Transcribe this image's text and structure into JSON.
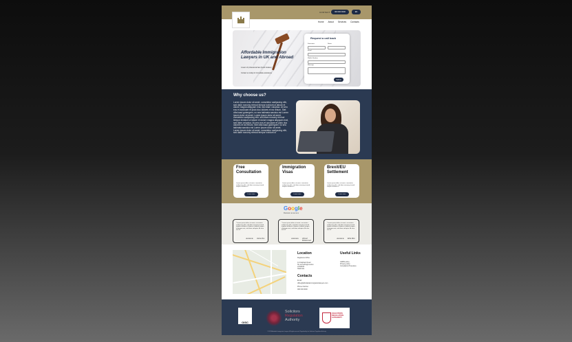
{
  "header": {
    "contact_label": "CONTACT",
    "phone_label": "000 000 0000",
    "lang_label": "EN"
  },
  "nav": [
    "Home",
    "About",
    "Services",
    "Contacts"
  ],
  "hero": {
    "title": "Affordable Immigration Lawyers in UK and Abroad",
    "subtitle1": "A team of professional law (Good Grades)",
    "subtitle2": "Contact us today for immediate assistance",
    "form": {
      "title": "Request a call back",
      "name_label": "Forename",
      "surname_label": "Name",
      "email_label": "Email",
      "phone_label": "Mobile Number",
      "message_label": "Message",
      "submit_label": "Submit"
    }
  },
  "why": {
    "title": "Why choose us?",
    "paragraph1": "Lorem ipsum dolor sit amet, consetetur sadipscing elitr, sed diam nonumy eirmod tempor invidunt ut labore et dolore magna aliquyam erat, sed diam voluptua. At vero eos et accusam et justo duo dolores et ea rebum. Stet clita kasd gubergren, no sea takimata sanctus est Lorem ipsum dolor sit amet. Lorem ipsum dolor sit amet, consetetur sadipscing elitr, sed diam nonumy eirmod tempor invidunt ut labore et dolore magna aliquyam erat, sed diam voluptua. At vero eos et accusam et justo duo dolores et ea rebum. Stet clita kasd gubergren, no sea takimata sanctus est Lorem ipsum dolor sit amet.",
    "paragraph2": "Lorem ipsum dolor sit amet, consetetur sadipscing elitr, sed diam nonumy eirmod tempor invidunt ut"
  },
  "services": [
    {
      "title": "Free Consultation",
      "text": "Lorem ipsum dolor sit amet, consetetur sadipscing elitr, sed diam nonumy eirmod tempor invidunt ut",
      "button": "Learn more"
    },
    {
      "title": "Immigration Visas",
      "text": "Lorem ipsum dolor sit amet, consetetur sadipscing elitr, sed diam nonumy eirmod tempor invidunt ut",
      "button": "Learn more"
    },
    {
      "title": "Brexit/EU Settlement",
      "text": "Lorem ipsum dolor sit amet, consetetur sadipscing elitr, sed diam nonumy eirmod tempor invidunt ut",
      "button": "Learn more"
    }
  ],
  "reviews": {
    "brand_letters": [
      "G",
      "o",
      "o",
      "g",
      "l",
      "e"
    ],
    "subtitle": "Reviews ★★★★★",
    "items": [
      {
        "text": "\"Lorem ipsum dolor sit amet, consetetur sadipscing elitr, sed diam nonumy eirmod tempor invidunt ut labore et dolore magna aliquyam erat, sed diam voluptua. At vero eos et\"",
        "stars": "★★★★★",
        "name": "Jamie Zoe"
      },
      {
        "text": "\"Lorem ipsum dolor sit amet, consetetur sadipscing elitr, sed diam nonumy eirmod tempor invidunt ut labore et dolore magna aliquyam erat, sed diam voluptua. At vero eos et\"",
        "stars": "★★★★★",
        "name": "Ahmed Mohammed"
      },
      {
        "text": "\"Lorem ipsum dolor sit amet, consetetur sadipscing elitr, sed diam nonumy eirmod tempor invidunt ut labore et dolore magna aliquyam erat, sed diam voluptua. At vero eos et\"",
        "stars": "★★★★★",
        "name": "Eliza Rice"
      }
    ]
  },
  "location": {
    "title": "Location",
    "subtitle": "Registered office",
    "address": [
      "14 Clapham Road",
      "Str-something/London",
      "LONDON",
      "SW9 0JG"
    ],
    "useful_title": "Useful Links",
    "links": [
      "GDPR policy",
      "Privacy policy",
      "Complaints Procedure"
    ],
    "contacts_title": "Contacts",
    "email_label": "Email",
    "email": "office@affordableimmigrationlawyers.com",
    "phone_label": "Phone Number",
    "phone": "000 000 0000"
  },
  "footer": {
    "oisc_label": "OISC",
    "sra_line1": "Solicitors",
    "sra_line2": "Regulation",
    "sra_line3": "Authority",
    "sra_badge_text": "SOLICITORS REGULATION AUTHORITY",
    "copyright": "© 2023 Affordable Immigration Lawyers. All rights reserved. Regulated by the Solicitors Regulation Authority."
  },
  "colors": {
    "gold": "#a8976a",
    "navy": "#2b3a52",
    "button": "#1f2c45"
  }
}
